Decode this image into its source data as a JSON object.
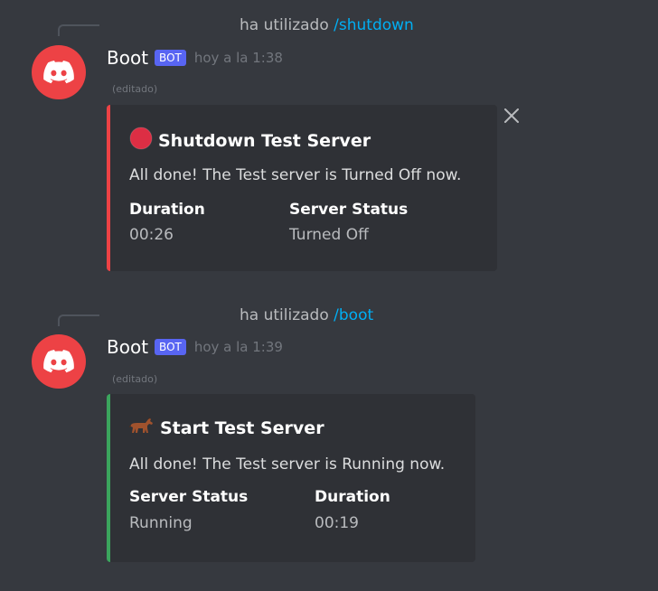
{
  "messages": [
    {
      "reply_prefix": "ha utilizado ",
      "reply_command": "/shutdown",
      "username": "Boot",
      "bot_tag": "BOT",
      "timestamp": "hoy a la 1:38",
      "edited": "(editado)",
      "embed": {
        "accent": "#ed4245",
        "emoji_icon": "red-circle-icon",
        "title": "Shutdown Test Server",
        "description": "All done! The Test server is Turned Off now.",
        "fields": [
          {
            "name": "Duration",
            "value": "00:26"
          },
          {
            "name": "Server Status",
            "value": "Turned Off"
          }
        ]
      }
    },
    {
      "reply_prefix": "ha utilizado ",
      "reply_command": "/boot",
      "username": "Boot",
      "bot_tag": "BOT",
      "timestamp": "hoy a la 1:39",
      "edited": "(editado)",
      "embed": {
        "accent": "#3ba55d",
        "emoji_icon": "horse-icon",
        "title": "Start Test Server",
        "description": "All done! The Test server is Running now.",
        "fields": [
          {
            "name": "Server Status",
            "value": "Running"
          },
          {
            "name": "Duration",
            "value": "00:19"
          }
        ]
      }
    }
  ],
  "colors": {
    "background": "#36393f",
    "embed_background": "#2f3136",
    "avatar": "#ed4245",
    "bot_tag": "#5865f2",
    "command_link": "#00aff4"
  }
}
